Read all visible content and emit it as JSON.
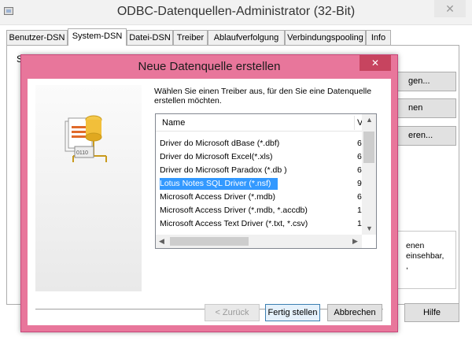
{
  "parent": {
    "title": "ODBC-Datenquellen-Administrator (32-Bit)",
    "close_label": "✕",
    "tabs": [
      {
        "label": "Benutzer-DSN"
      },
      {
        "label": "System-DSN"
      },
      {
        "label": "Datei-DSN"
      },
      {
        "label": "Treiber"
      },
      {
        "label": "Ablaufverfolgung"
      },
      {
        "label": "Verbindungspooling"
      },
      {
        "label": "Info"
      }
    ],
    "active_tab": "System-DSN",
    "panel_fragment": "S",
    "side_buttons": [
      "gen...",
      "nen",
      "eren..."
    ],
    "info_text": [
      "enen",
      "einsehbar,",
      ","
    ],
    "help_label": "Hilfe"
  },
  "dialog": {
    "title": "Neue Datenquelle erstellen",
    "close_label": "✕",
    "prompt_line1": "Wählen Sie einen Treiber aus, für den Sie eine Datenquelle",
    "prompt_line2": "erstellen möchten.",
    "list": {
      "col_name": "Name",
      "col_version": "V",
      "rows": [
        {
          "name": "Driver do Microsoft dBase (*.dbf)",
          "version": "6"
        },
        {
          "name": "Driver do Microsoft Excel(*.xls)",
          "version": "6"
        },
        {
          "name": "Driver do Microsoft Paradox (*.db )",
          "version": "6"
        },
        {
          "name": "Lotus Notes SQL Driver (*.nsf)",
          "version": "9"
        },
        {
          "name": "Microsoft Access Driver (*.mdb)",
          "version": "6"
        },
        {
          "name": "Microsoft Access Driver (*.mdb, *.accdb)",
          "version": "1"
        },
        {
          "name": "Microsoft Access Text Driver (*.txt, *.csv)",
          "version": "1"
        }
      ],
      "selected_row": "Lotus Notes SQL Driver (*.nsf)"
    },
    "buttons": {
      "back": "< Zurück",
      "finish": "Fertig stellen",
      "cancel": "Abbrechen"
    },
    "colors": {
      "frame": "#e8769b",
      "selection": "#3399ff"
    }
  },
  "icons": {
    "dialog_art": "database-drivers-illustration",
    "parent_app": "odbc-admin-icon"
  }
}
